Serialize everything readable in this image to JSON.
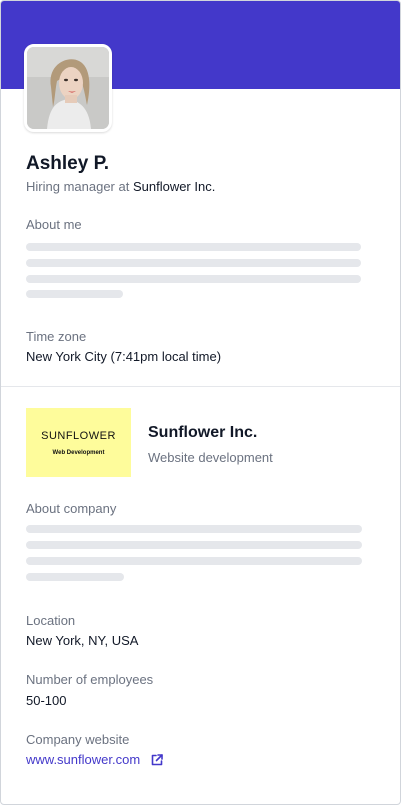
{
  "profile": {
    "name": "Ashley P.",
    "role_prefix": "Hiring manager at ",
    "role_company": "Sunflower Inc.",
    "about_label": "About me",
    "timezone_label": "Time zone",
    "timezone_value": "New York City (7:41pm local time)"
  },
  "company": {
    "logo_title": "SUNFLOWER",
    "logo_subtitle": "Web Development",
    "name": "Sunflower Inc.",
    "type": "Website development",
    "about_label": "About company",
    "location_label": "Location",
    "location_value": "New York, NY, USA",
    "employees_label": "Number of employees",
    "employees_value": "50-100",
    "website_label": "Company website",
    "website_value": "www.sunflower.com",
    "website_icon": "external-link-icon"
  },
  "colors": {
    "cover": "#4338ca",
    "link": "#4338ca",
    "logo_bg": "#fefc9b",
    "skeleton": "#e5e7eb"
  }
}
